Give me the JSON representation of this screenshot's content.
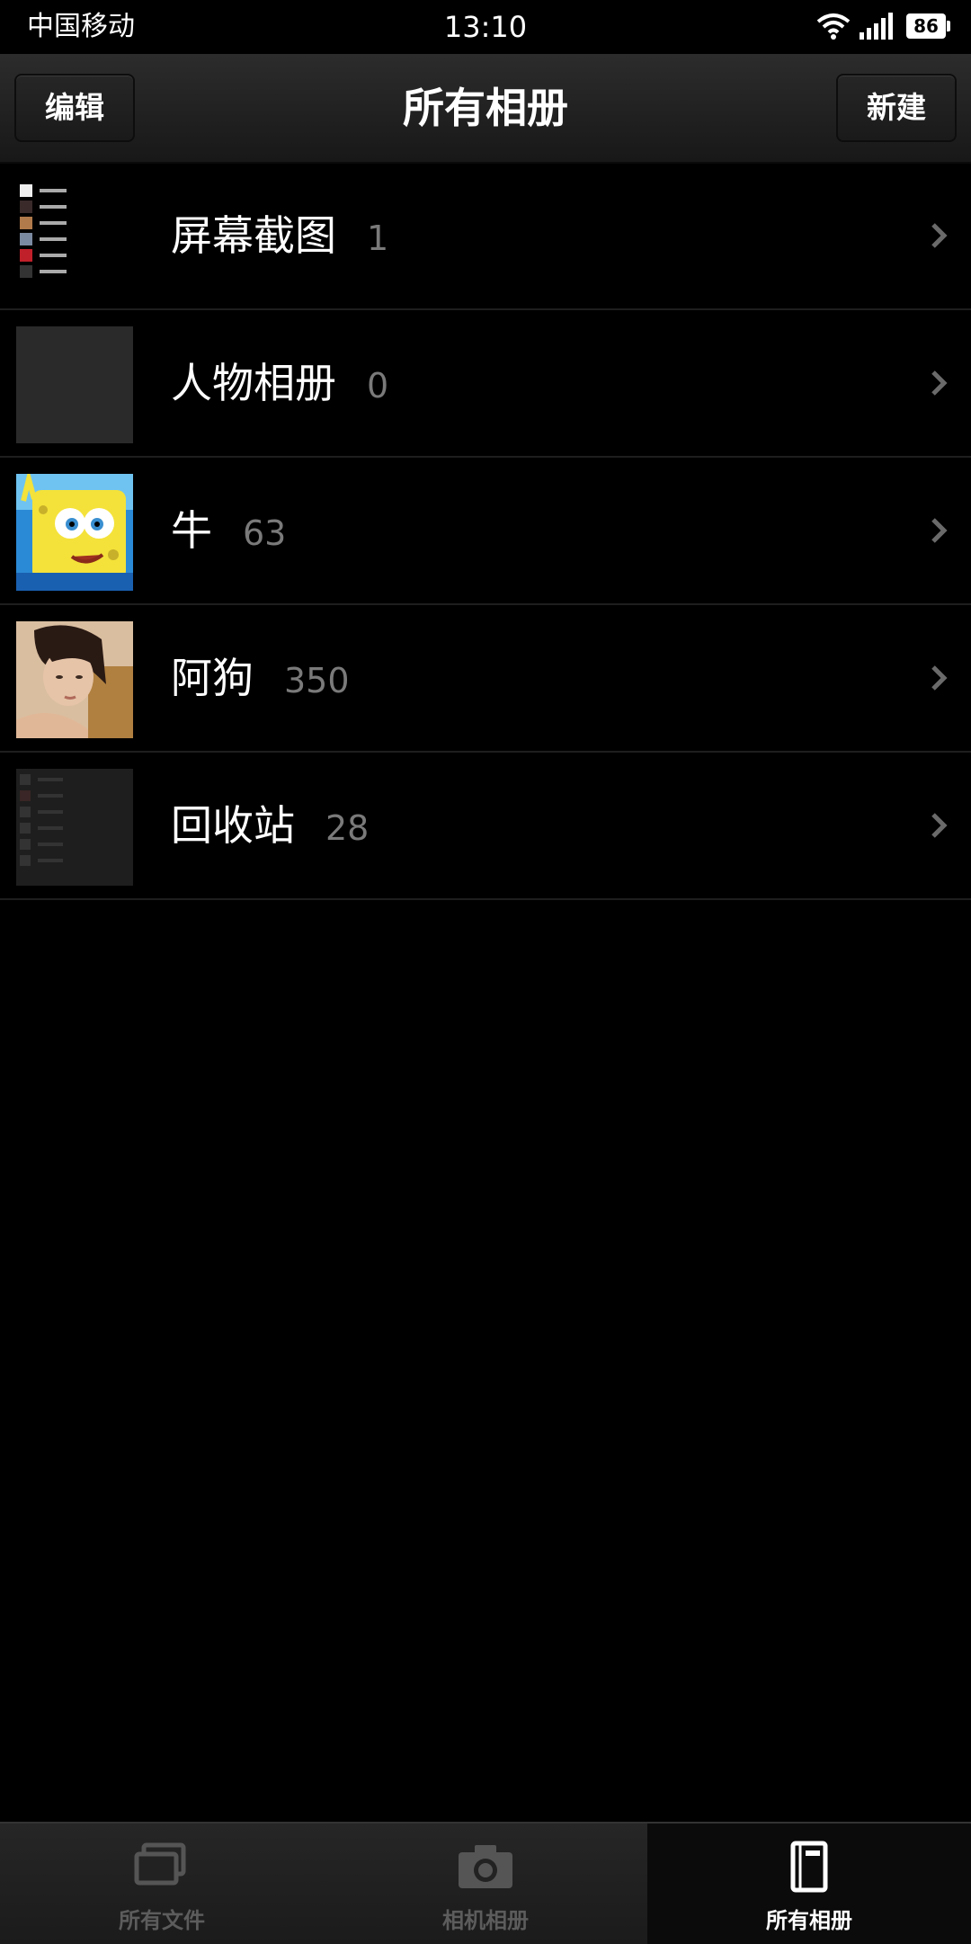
{
  "status_bar": {
    "carrier": "中国移动",
    "time": "13:10",
    "battery": "86"
  },
  "header": {
    "title": "所有相册",
    "left_button": "编辑",
    "right_button": "新建"
  },
  "albums": [
    {
      "name": "屏幕截图",
      "count": "1"
    },
    {
      "name": "人物相册",
      "count": "0"
    },
    {
      "name": "牛",
      "count": "63"
    },
    {
      "name": "阿狗",
      "count": "350"
    },
    {
      "name": "回收站",
      "count": "28"
    }
  ],
  "tab_bar": {
    "tabs": [
      {
        "label": "所有文件",
        "icon": "files-icon",
        "active": false
      },
      {
        "label": "相机相册",
        "icon": "camera-icon",
        "active": false
      },
      {
        "label": "所有相册",
        "icon": "album-icon",
        "active": true
      }
    ]
  }
}
